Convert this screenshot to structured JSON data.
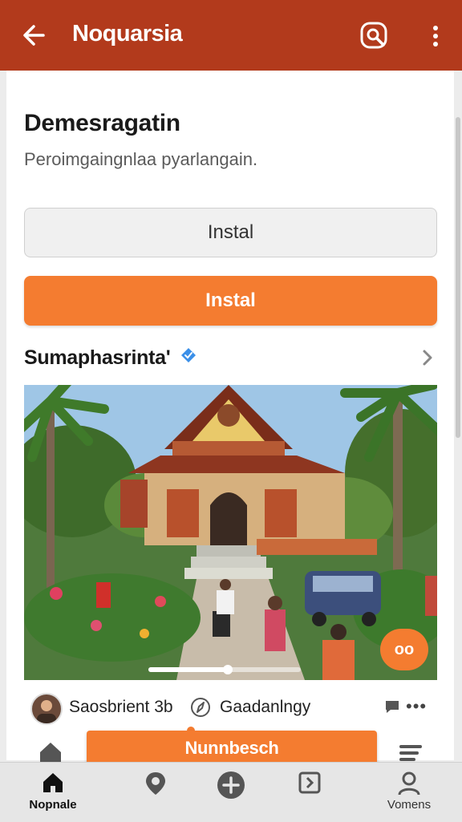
{
  "app_bar": {
    "title": "Noquarsia",
    "back_icon": "arrow-back-icon",
    "search_icon": "search-icon",
    "more_icon": "more-vertical-icon",
    "color": "#b23a1c"
  },
  "content": {
    "heading": "Demesragatin",
    "subtext": "Peroimgaingnlaa pyarlangain.",
    "secondary_button_label": "Instal",
    "primary_button_label": "Instal",
    "accent_color": "#f47c30"
  },
  "section": {
    "title": "Sumaphasrinta'",
    "verified_icon": "verified-badge-icon",
    "chevron_icon": "chevron-right-icon"
  },
  "media": {
    "image_alt": "Traditional house with tiled roof surrounded by palm trees and people",
    "badge_text": "oo",
    "progress": 0.52
  },
  "post_meta": {
    "author": "Saosbrient 3b",
    "location": "Gaadanlngy",
    "compass_icon": "compass-icon",
    "comment_icon": "comment-icon",
    "more_label": "•••"
  },
  "floating_bar": {
    "label": "Nunnbesch"
  },
  "bottom_nav": {
    "items": [
      {
        "label": "Nopnale",
        "icon": "home-icon",
        "active": true
      },
      {
        "label": "",
        "icon": "location-pin-icon",
        "active": false
      },
      {
        "label": "",
        "icon": "add-circle-icon",
        "active": false
      },
      {
        "label": "",
        "icon": "page-icon",
        "active": false
      },
      {
        "label": "Vomens",
        "icon": "profile-icon",
        "active": false
      }
    ]
  }
}
